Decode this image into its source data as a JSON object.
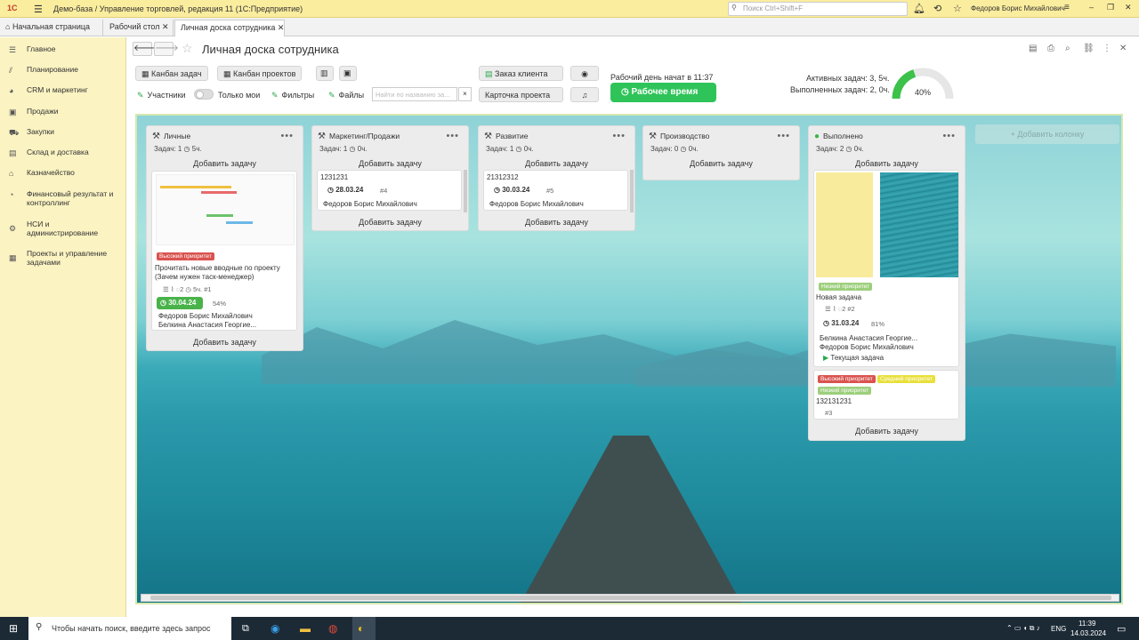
{
  "window": {
    "logo": "1С",
    "title": "Демо-база / Управление торговлей, редакция 11  (1С:Предприятие)",
    "search_placeholder": "Поиск Ctrl+Shift+F",
    "user": "Федоров Борис Михайлович"
  },
  "tabs": [
    {
      "label": "Начальная страница"
    },
    {
      "label": "Рабочий стол"
    },
    {
      "label": "Личная доска сотрудника"
    }
  ],
  "sidebar": {
    "items": [
      {
        "label": "Главное",
        "icon": "menu-icon"
      },
      {
        "label": "Планирование",
        "icon": "chart-icon"
      },
      {
        "label": "CRM и маркетинг",
        "icon": "pie-icon"
      },
      {
        "label": "Продажи",
        "icon": "bag-icon"
      },
      {
        "label": "Закупки",
        "icon": "cart-icon"
      },
      {
        "label": "Склад и доставка",
        "icon": "truck-icon"
      },
      {
        "label": "Казначейство",
        "icon": "bank-icon"
      },
      {
        "label": "Финансовый результат и контроллинг",
        "icon": "finance-icon"
      },
      {
        "label": "НСИ и администрирование",
        "icon": "gear-icon"
      },
      {
        "label": "Проекты и управление задачами",
        "icon": "projects-icon"
      }
    ]
  },
  "page": {
    "title": "Личная доска сотрудника"
  },
  "toolbar": {
    "kanban_tasks": "Канбан задач",
    "kanban_projects": "Канбан проектов",
    "client_order": "Заказ клиента",
    "project_card": "Карточка проекта",
    "participants": "Участники",
    "only_mine": "Только мои",
    "filters": "Фильтры",
    "files": "Файлы",
    "search_placeholder": "Найти по названию за..."
  },
  "workday": {
    "started": "Рабочий день начат в 11:37",
    "button": "Рабочее время"
  },
  "stats": {
    "active": "Активных задач: 3, 5ч.",
    "done": "Выполненных задач: 2, 0ч.",
    "percent_label": "40%",
    "percent": 0.4,
    "accent": "#3cc24a"
  },
  "board": {
    "add_column": "+ Добавить колонку",
    "add_task": "Добавить задачу",
    "columns": [
      {
        "name": "Личные",
        "tasks": "Задач: 1",
        "hours": "5ч."
      },
      {
        "name": "Маркетинг/Продажи",
        "tasks": "Задач: 1",
        "hours": "0ч."
      },
      {
        "name": "Развитие",
        "tasks": "Задач: 1",
        "hours": "0ч."
      },
      {
        "name": "Производство",
        "tasks": "Задач: 0",
        "hours": "0ч."
      },
      {
        "name": "Выполнено",
        "tasks": "Задач: 2",
        "hours": "0ч."
      }
    ]
  },
  "cards": {
    "c1": {
      "priority": "Высокий приоритет",
      "title_line1": "Прочитать новые вводные по проекту",
      "title_line2": "(Зачем нужен таск-менеджер)",
      "comments": "2",
      "hours": "5ч.",
      "num": "#1",
      "date": "30.04.24",
      "progress": "54%",
      "user1": "Федоров Борис Михайлович",
      "user2": "Белкина Анастасия Георгие..."
    },
    "c2": {
      "code": "1231231",
      "date": "28.03.24",
      "num": "#4",
      "user": "Федоров Борис Михайлович"
    },
    "c3": {
      "code": "21312312",
      "date": "30.03.24",
      "num": "#5",
      "user": "Федоров Борис Михайлович"
    },
    "c4": {
      "priority": "Низкий приоритет",
      "title": "Новая задача",
      "comments": "2",
      "num": "#2",
      "date": "31.03.24",
      "progress": "81%",
      "user1": "Белкина Анастасия Георгие...",
      "user2": "Федоров Борис Михайлович",
      "current": "Текущая задача"
    },
    "c5": {
      "tag1": "Высокий приоритет",
      "tag2": "Средний приоритет",
      "tag3": "Низкий приоритет",
      "code": "132131231",
      "num": "#3"
    }
  },
  "taskbar": {
    "search": "Чтобы начать поиск, введите здесь запрос",
    "lang": "ENG",
    "time": "11:39",
    "date": "14.03.2024"
  }
}
